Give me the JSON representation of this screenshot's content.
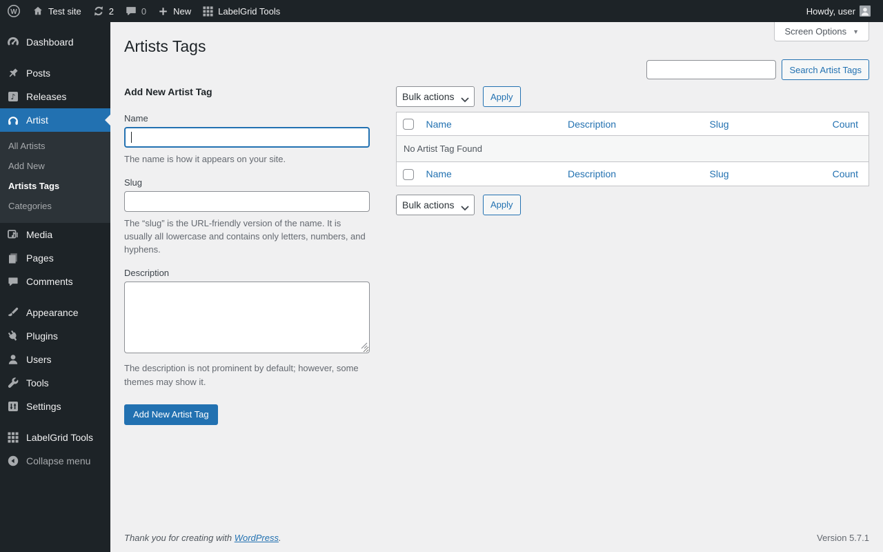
{
  "admin_bar": {
    "site_name": "Test site",
    "updates_count": "2",
    "comments_count": "0",
    "new_label": "New",
    "labelgrid_label": "LabelGrid Tools",
    "howdy": "Howdy, user"
  },
  "sidebar": {
    "items": [
      {
        "label": "Dashboard"
      },
      {
        "label": "Posts"
      },
      {
        "label": "Releases"
      },
      {
        "label": "Artist"
      },
      {
        "label": "Media"
      },
      {
        "label": "Pages"
      },
      {
        "label": "Comments"
      },
      {
        "label": "Appearance"
      },
      {
        "label": "Plugins"
      },
      {
        "label": "Users"
      },
      {
        "label": "Tools"
      },
      {
        "label": "Settings"
      },
      {
        "label": "LabelGrid Tools"
      }
    ],
    "submenu": [
      {
        "label": "All Artists"
      },
      {
        "label": "Add New"
      },
      {
        "label": "Artists Tags"
      },
      {
        "label": "Categories"
      }
    ],
    "collapse_label": "Collapse menu"
  },
  "main": {
    "title": "Artists Tags",
    "screen_options_label": "Screen Options",
    "search_button_label": "Search Artist Tags",
    "form": {
      "heading": "Add New Artist Tag",
      "name_label": "Name",
      "name_help": "The name is how it appears on your site.",
      "slug_label": "Slug",
      "slug_help": "The “slug” is the URL-friendly version of the name. It is usually all lowercase and contains only letters, numbers, and hyphens.",
      "description_label": "Description",
      "description_help": "The description is not prominent by default; however, some themes may show it.",
      "submit_label": "Add New Artist Tag"
    },
    "list": {
      "bulk_actions_label": "Bulk actions",
      "apply_label": "Apply",
      "columns": [
        "Name",
        "Description",
        "Slug",
        "Count"
      ],
      "empty_message": "No Artist Tag Found"
    }
  },
  "footer": {
    "thanks_prefix": "Thank you for creating with ",
    "wordpress_link": "WordPress",
    "thanks_suffix": ".",
    "version": "Version 5.7.1"
  },
  "icons": {
    "screen_options_chevron": "▼",
    "releases_note": "♪"
  },
  "colors": {
    "accent": "#2271b1",
    "admin_bar_bg": "#1d2327",
    "menu_bg": "#1d2327",
    "submenu_bg": "#2c3338",
    "content_bg": "#f0f0f1",
    "table_border": "#c3c4c7"
  }
}
